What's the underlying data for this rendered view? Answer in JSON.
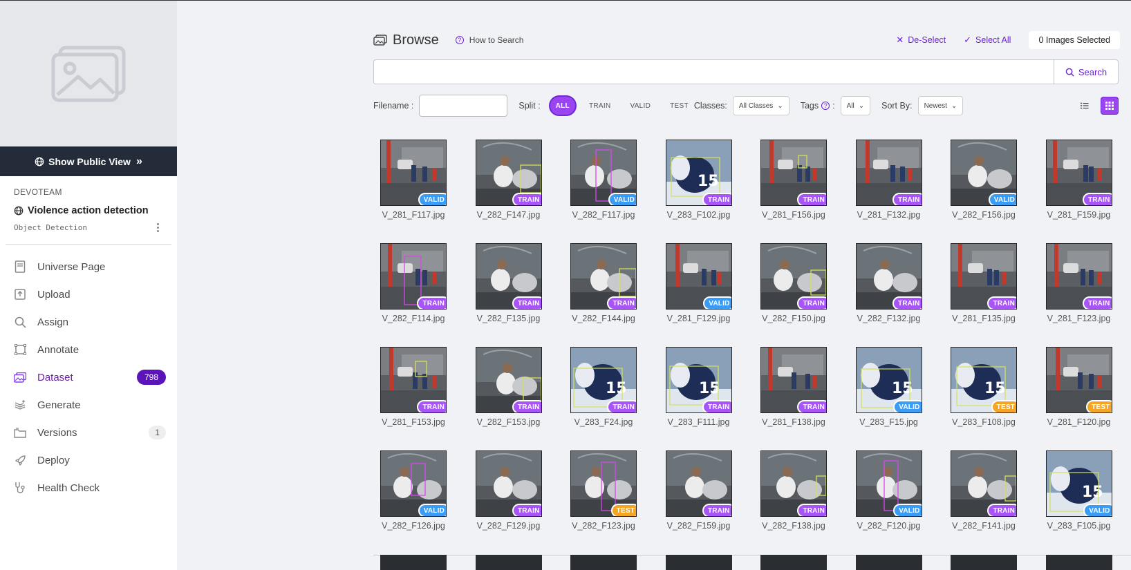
{
  "sidebar": {
    "public_view_label": "Show Public View",
    "workspace": "DEVOTEAM",
    "project_name": "Violence action detection",
    "project_type": "Object Detection",
    "nav": [
      {
        "label": "Universe Page",
        "icon": "book-icon",
        "count": ""
      },
      {
        "label": "Upload",
        "icon": "upload-icon",
        "count": ""
      },
      {
        "label": "Assign",
        "icon": "search-icon",
        "count": ""
      },
      {
        "label": "Annotate",
        "icon": "annotate-icon",
        "count": ""
      },
      {
        "label": "Dataset",
        "icon": "images-icon",
        "count": "798",
        "active": true
      },
      {
        "label": "Generate",
        "icon": "layers-icon",
        "count": ""
      },
      {
        "label": "Versions",
        "icon": "folder-icon",
        "count": "1"
      },
      {
        "label": "Deploy",
        "icon": "rocket-icon",
        "count": ""
      },
      {
        "label": "Health Check",
        "icon": "stethoscope-icon",
        "count": ""
      }
    ]
  },
  "header": {
    "title": "Browse",
    "how_to": "How to Search",
    "deselect": "De-Select",
    "select_all": "Select All",
    "selected_count": "0 Images Selected"
  },
  "search": {
    "placeholder": "",
    "button": "Search"
  },
  "filters": {
    "filename_label": "Filename :",
    "split_label": "Split :",
    "split_options": [
      "ALL",
      "TRAIN",
      "VALID",
      "TEST"
    ],
    "split_selected": "ALL",
    "classes_label": "Classes:",
    "classes_value": "All Classes",
    "tags_label": "Tags",
    "tags_value": "All",
    "sort_label": "Sort By:",
    "sort_value": "Newest"
  },
  "images": [
    {
      "name": "V_281_F117.jpg",
      "split": "VALID",
      "scene": "street"
    },
    {
      "name": "V_282_F147.jpg",
      "split": "TRAIN",
      "scene": "fight"
    },
    {
      "name": "V_282_F117.jpg",
      "split": "VALID",
      "scene": "fight"
    },
    {
      "name": "V_283_F102.jpg",
      "split": "TRAIN",
      "scene": "hockey"
    },
    {
      "name": "V_281_F156.jpg",
      "split": "TRAIN",
      "scene": "street"
    },
    {
      "name": "V_281_F132.jpg",
      "split": "TRAIN",
      "scene": "street"
    },
    {
      "name": "V_282_F156.jpg",
      "split": "VALID",
      "scene": "fight"
    },
    {
      "name": "V_281_F159.jpg",
      "split": "TRAIN",
      "scene": "street"
    },
    {
      "name": "V_282_F114.jpg",
      "split": "TRAIN",
      "scene": "street"
    },
    {
      "name": "V_282_F135.jpg",
      "split": "TRAIN",
      "scene": "fight"
    },
    {
      "name": "V_282_F144.jpg",
      "split": "TRAIN",
      "scene": "fight"
    },
    {
      "name": "V_281_F129.jpg",
      "split": "VALID",
      "scene": "street"
    },
    {
      "name": "V_282_F150.jpg",
      "split": "TRAIN",
      "scene": "fight"
    },
    {
      "name": "V_282_F132.jpg",
      "split": "TRAIN",
      "scene": "fight"
    },
    {
      "name": "V_281_F135.jpg",
      "split": "TRAIN",
      "scene": "street"
    },
    {
      "name": "V_281_F123.jpg",
      "split": "TRAIN",
      "scene": "street"
    },
    {
      "name": "V_281_F153.jpg",
      "split": "TRAIN",
      "scene": "street"
    },
    {
      "name": "V_282_F153.jpg",
      "split": "TRAIN",
      "scene": "fight"
    },
    {
      "name": "V_283_F24.jpg",
      "split": "TRAIN",
      "scene": "hockey"
    },
    {
      "name": "V_283_F111.jpg",
      "split": "TRAIN",
      "scene": "hockey"
    },
    {
      "name": "V_281_F138.jpg",
      "split": "TRAIN",
      "scene": "street"
    },
    {
      "name": "V_283_F15.jpg",
      "split": "VALID",
      "scene": "hockey"
    },
    {
      "name": "V_283_F108.jpg",
      "split": "TEST",
      "scene": "hockey"
    },
    {
      "name": "V_281_F120.jpg",
      "split": "TEST",
      "scene": "street"
    },
    {
      "name": "V_282_F126.jpg",
      "split": "VALID",
      "scene": "fight"
    },
    {
      "name": "V_282_F129.jpg",
      "split": "TRAIN",
      "scene": "fight"
    },
    {
      "name": "V_282_F123.jpg",
      "split": "TEST",
      "scene": "fight"
    },
    {
      "name": "V_282_F159.jpg",
      "split": "TRAIN",
      "scene": "fight"
    },
    {
      "name": "V_282_F138.jpg",
      "split": "TRAIN",
      "scene": "fight"
    },
    {
      "name": "V_282_F120.jpg",
      "split": "VALID",
      "scene": "fight"
    },
    {
      "name": "V_282_F141.jpg",
      "split": "TRAIN",
      "scene": "fight"
    },
    {
      "name": "V_283_F105.jpg",
      "split": "VALID",
      "scene": "hockey"
    }
  ],
  "colors": {
    "accent": "#7c3aed",
    "train": "#a855f7",
    "valid": "#3b9cf6",
    "test": "#f5a524",
    "sidebar_dark": "#232c38"
  }
}
